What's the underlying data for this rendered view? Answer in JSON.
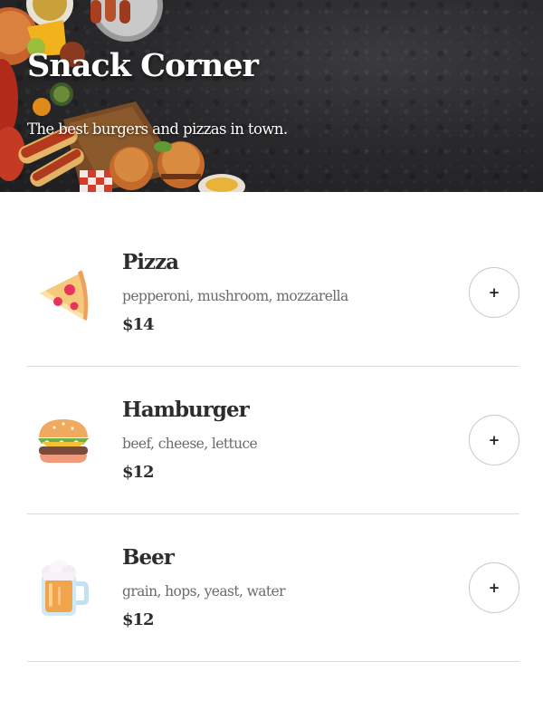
{
  "header": {
    "title": "Snack Corner",
    "subtitle": "The best burgers and pizzas in town."
  },
  "menu": {
    "items": [
      {
        "name": "Pizza",
        "ingredients": "pepperoni, mushroom, mozzarella",
        "price": "$14",
        "icon": "pizza-icon",
        "add_label": "+"
      },
      {
        "name": "Hamburger",
        "ingredients": "beef, cheese, lettuce",
        "price": "$12",
        "icon": "hamburger-icon",
        "add_label": "+"
      },
      {
        "name": "Beer",
        "ingredients": "grain, hops, yeast, water",
        "price": "$12",
        "icon": "beer-icon",
        "add_label": "+"
      }
    ]
  }
}
